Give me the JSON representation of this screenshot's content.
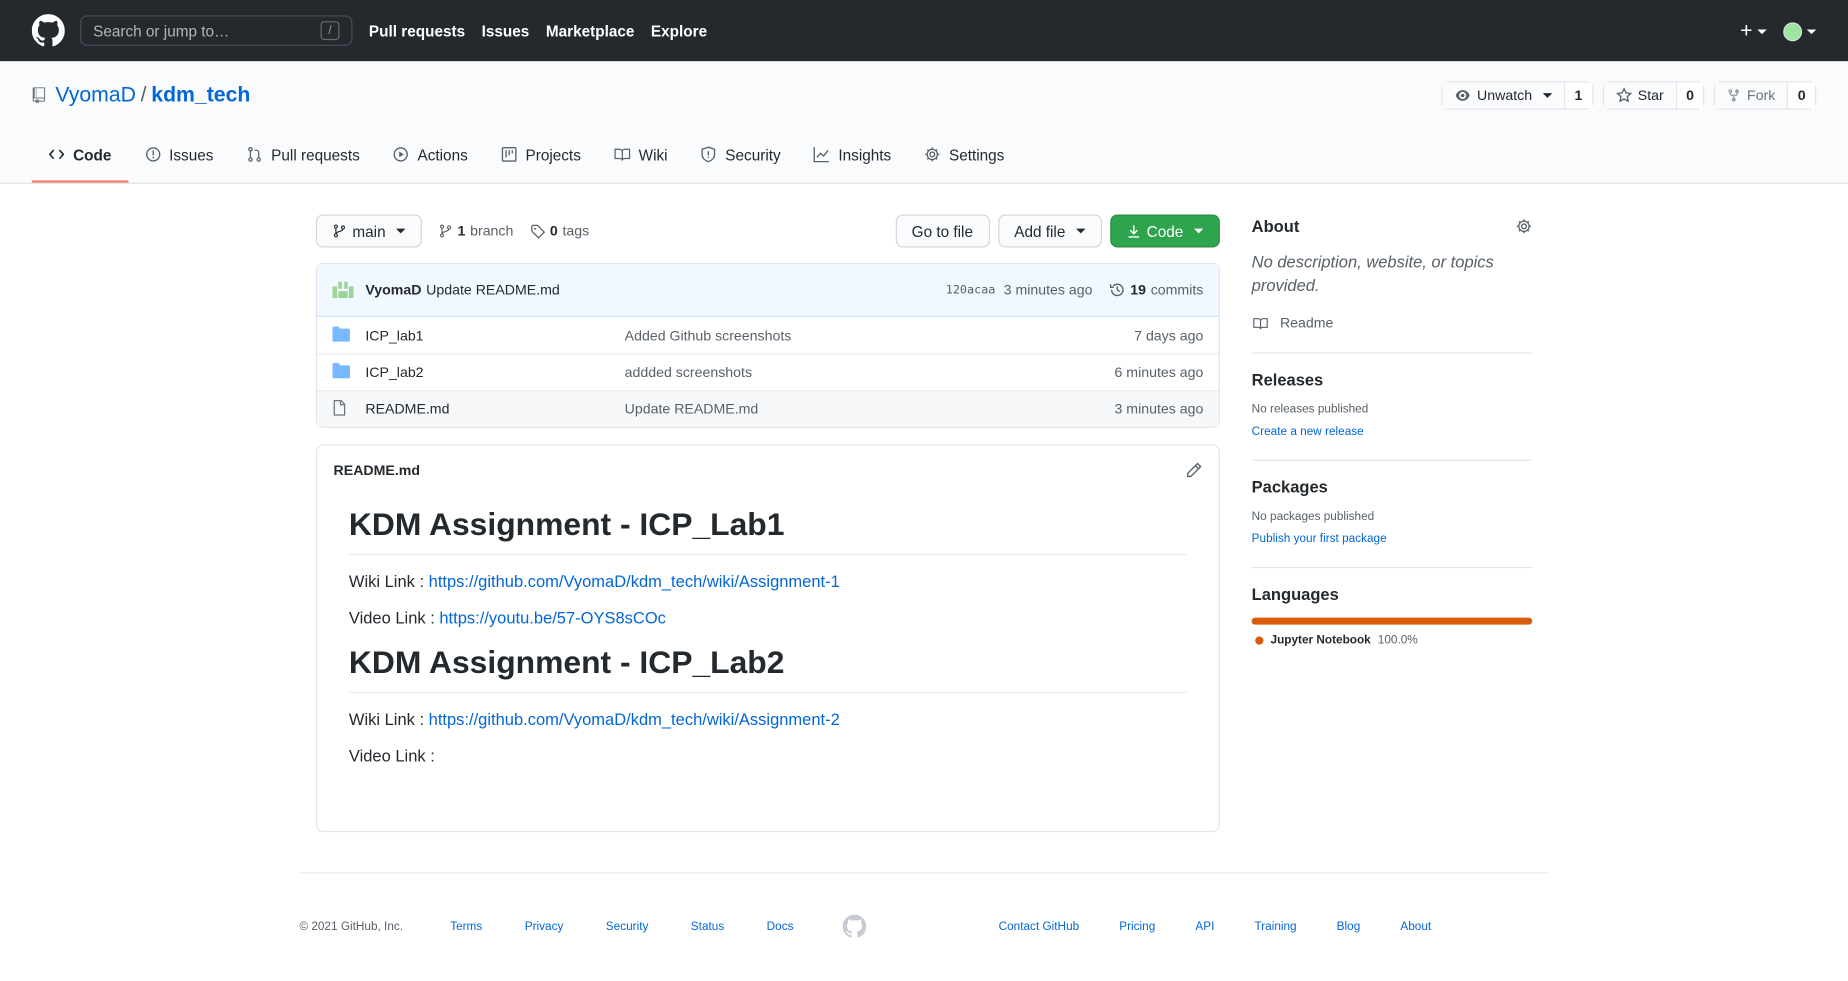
{
  "header": {
    "search_placeholder": "Search or jump to…",
    "slash_key": "/",
    "nav": [
      "Pull requests",
      "Issues",
      "Marketplace",
      "Explore"
    ],
    "plus": "+"
  },
  "repo": {
    "owner": "VyomaD",
    "separator": "/",
    "name": "kdm_tech",
    "watch_label": "Unwatch",
    "watch_count": "1",
    "star_label": "Star",
    "star_count": "0",
    "fork_label": "Fork",
    "fork_count": "0"
  },
  "tabs": [
    "Code",
    "Issues",
    "Pull requests",
    "Actions",
    "Projects",
    "Wiki",
    "Security",
    "Insights",
    "Settings"
  ],
  "file_nav": {
    "branch": "main",
    "branch_count": "1",
    "branch_label": "branch",
    "tag_count": "0",
    "tag_label": "tags",
    "go_to_file": "Go to file",
    "add_file": "Add file",
    "code": "Code"
  },
  "latest_commit": {
    "author": "VyomaD",
    "message": "Update README.md",
    "sha": "120acaa",
    "time": "3 minutes ago",
    "commit_count": "19",
    "commit_label": "commits"
  },
  "files": [
    {
      "name": "ICP_lab1",
      "type": "folder",
      "message": "Added Github screenshots",
      "age": "7 days ago"
    },
    {
      "name": "ICP_lab2",
      "type": "folder",
      "message": "addded screenshots",
      "age": "6 minutes ago"
    },
    {
      "name": "README.md",
      "type": "file",
      "message": "Update README.md",
      "age": "3 minutes ago"
    }
  ],
  "readme": {
    "filename": "README.md",
    "h1_a": "KDM Assignment - ICP_Lab1",
    "wiki_prefix": "Wiki Link : ",
    "video_prefix": "Video Link : ",
    "wiki_a": "https://github.com/VyomaD/kdm_tech/wiki/Assignment-1",
    "video_a": "https://youtu.be/57-OYS8sCOc",
    "h1_b": "KDM Assignment - ICP_Lab2",
    "wiki_b": "https://github.com/VyomaD/kdm_tech/wiki/Assignment-2",
    "video_b_text": "Video Link :"
  },
  "sidebar": {
    "about_title": "About",
    "about_text": "No description, website, or topics provided.",
    "readme_label": "Readme",
    "releases_title": "Releases",
    "releases_none": "No releases published",
    "releases_link": "Create a new release",
    "packages_title": "Packages",
    "packages_none": "No packages published",
    "packages_link": "Publish your first package",
    "languages_title": "Languages",
    "language_name": "Jupyter Notebook",
    "language_pct": "100.0%",
    "language_color": "#da5b0b"
  },
  "footer": {
    "copyright": "© 2021 GitHub, Inc.",
    "left_links": [
      "Terms",
      "Privacy",
      "Security",
      "Status",
      "Docs"
    ],
    "right_links": [
      "Contact GitHub",
      "Pricing",
      "API",
      "Training",
      "Blog",
      "About"
    ]
  }
}
